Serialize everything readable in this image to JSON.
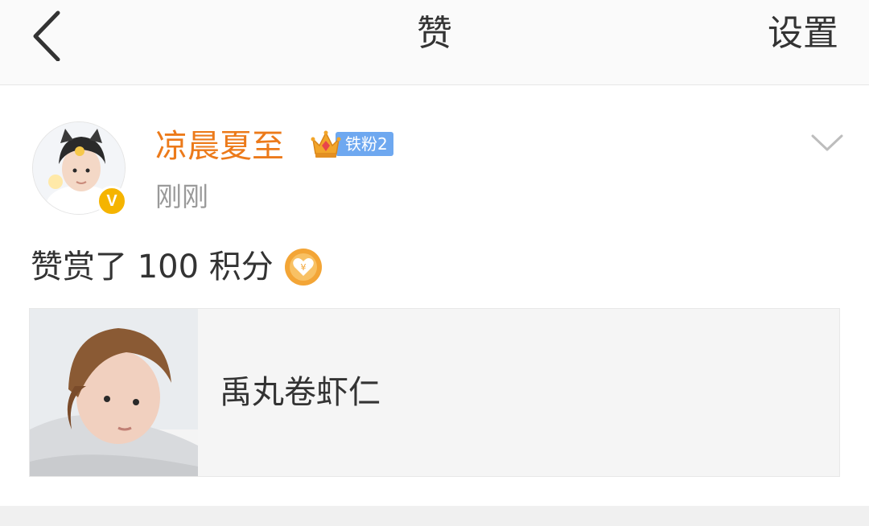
{
  "header": {
    "back_icon": "chevron-left-icon",
    "title": "赞",
    "settings_label": "设置"
  },
  "post": {
    "user": {
      "name": "凉晨夏至",
      "verified_icon": "verified-v-icon",
      "verified_letter": "V",
      "fan_badge_icon": "crown-icon",
      "fan_badge_label": "铁粉2"
    },
    "time": "刚刚",
    "dropdown_icon": "chevron-down-icon",
    "text": "赞赏了 100 积分",
    "coin_icon": "heart-coin-icon",
    "coin_symbol": "¥",
    "card": {
      "title": "禹丸卷虾仁"
    }
  },
  "colors": {
    "username": "#ec7a1a",
    "fan_badge": "#6ea8f0",
    "verified": "#f5b400",
    "coin": "#f3a536",
    "time": "#9a9a9a"
  }
}
